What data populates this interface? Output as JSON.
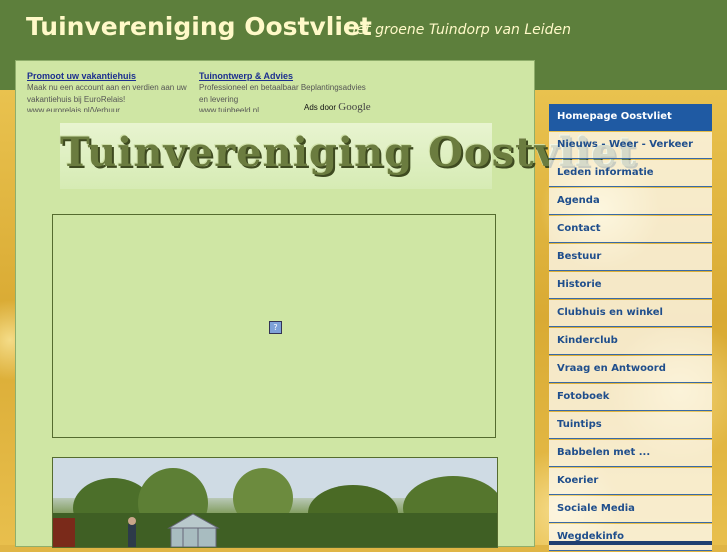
{
  "header": {
    "title": "Tuinvereniging Oostvliet",
    "tagline": "Hét groene Tuindorp van Leiden"
  },
  "ads": [
    {
      "title": "Promoot uw vakantiehuis",
      "text": "Maak nu een account aan en verdien aan uw vakantiehuis bij EuroRelais!",
      "url": "www.eurorelais.nl/Verhuur"
    },
    {
      "title": "Tuinontwerp & Advies",
      "text": "Professioneel en betaalbaar Beplantingsadvies en levering",
      "url": "www.tuinbeeld.nl"
    }
  ],
  "ads_by": {
    "label": "Ads door",
    "brand": "Google"
  },
  "logo": {
    "text": "Tuinvereniging Oostvliet"
  },
  "media": {
    "broken_icon": "broken-image-icon",
    "glyph": "?"
  },
  "nav": {
    "items": [
      {
        "label": "Homepage Oostvliet",
        "active": true
      },
      {
        "label": "Nieuws - Weer - Verkeer",
        "active": false
      },
      {
        "label": "Leden informatie",
        "active": false
      },
      {
        "label": "Agenda",
        "active": false
      },
      {
        "label": "Contact",
        "active": false
      },
      {
        "label": "Bestuur",
        "active": false
      },
      {
        "label": "Historie",
        "active": false
      },
      {
        "label": "Clubhuis en winkel",
        "active": false
      },
      {
        "label": "Kinderclub",
        "active": false
      },
      {
        "label": "Vraag en Antwoord",
        "active": false
      },
      {
        "label": "Fotoboek",
        "active": false
      },
      {
        "label": "Tuintips",
        "active": false
      },
      {
        "label": "Babbelen met ...",
        "active": false
      },
      {
        "label": "Koerier",
        "active": false
      },
      {
        "label": "Sociale Media",
        "active": false
      },
      {
        "label": "Wegdekinfo",
        "active": false
      }
    ]
  },
  "colors": {
    "header_bg": "#5d7f3c",
    "title_color": "#fff9c8",
    "content_bg": "#cfe6a4",
    "nav_active_bg": "#1f5aa3",
    "nav_text": "#1f4e8c"
  }
}
